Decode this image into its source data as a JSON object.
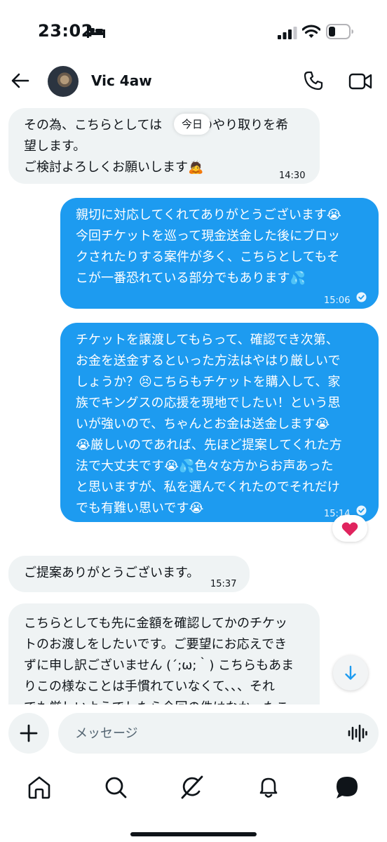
{
  "status_bar": {
    "time": "23:02"
  },
  "header": {
    "contact_name": "Vic 4aw"
  },
  "date_chip": "今日",
  "messages": [
    {
      "text": "その為、こちらとしては　　　のやり取りを希\n望します。\nご検討よろしくお願いします🙇",
      "time": "14:30",
      "direction": "incoming"
    },
    {
      "text": "親切に対応してくれてありがとうございます😭\n今回チケットを巡って現金送金した後にブロッ\nクされたりする案件が多く、こちらとしてもそ\nこが一番恐れている部分でもあります💦",
      "time": "15:06",
      "direction": "outgoing",
      "seen": true
    },
    {
      "text": "チケットを譲渡してもらって、確認でき次第、\nお金を送金するといった方法はやはり厳しいで\nしょうか？😣こちらもチケットを購入して、家\n族でキングスの応援を現地でしたい！という思\nいが強いので、ちゃんとお金は送金します😭\n😭厳しいのであれば、先ほど提案してくれた方\n法で大丈夫です😭💦色々な方からお声あった\nと思いますが、私を選んでくれたのでそれだけ\nでも有難い思いです😭",
      "time": "15:14",
      "direction": "outgoing",
      "seen": true,
      "reaction": "❤️"
    },
    {
      "text": "ご提案ありがとうございます。",
      "time": "15:37",
      "direction": "incoming"
    },
    {
      "text": "こちらとしても先に金額を確認してかのチケッ\nトのお渡しをしたいです。ご要望にお応えでき\nずに申し訳ございません (´;ω;｀) こちらもあま\nりこの様なことは手慣れていなくて、、、それ\nでも厳しいようでしたら今回の件はなかったこ",
      "time": "",
      "direction": "incoming"
    }
  ],
  "composer": {
    "placeholder": "メッセージ"
  },
  "tabs": [
    "home",
    "search",
    "grok",
    "notifications",
    "messages"
  ],
  "colors": {
    "accent": "#1d9bf0",
    "incoming_bubble": "#eff3f4",
    "text": "#0f1419",
    "reaction_heart": "#e0245e"
  }
}
